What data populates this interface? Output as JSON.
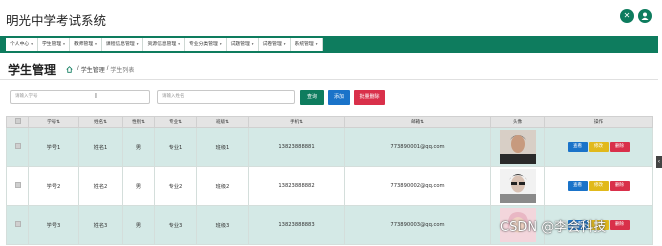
{
  "app": {
    "title": "明光中学考试系统"
  },
  "header_icons": [
    {
      "icon": "close-circle-icon",
      "glyph": "✕"
    },
    {
      "icon": "user-icon",
      "glyph": "●"
    }
  ],
  "nav": {
    "items": [
      "个人中心",
      "学生管理",
      "教师管理",
      "课程信息管理",
      "资源信息管理",
      "专业分类管理",
      "试题管理",
      "试卷管理",
      "系统管理"
    ],
    "caret": "▾"
  },
  "page": {
    "title": "学生管理",
    "breadcrumb": [
      "学生管理",
      "学生列表"
    ]
  },
  "search": {
    "student_no_placeholder": "请输入学号",
    "name_placeholder": "请输入姓名",
    "query_label": "查询",
    "add_label": "添加",
    "bulk_delete_label": "批量删除"
  },
  "table": {
    "headers": [
      "学号⇅",
      "姓名⇅",
      "性别⇅",
      "专业⇅",
      "班级⇅",
      "手机⇅",
      "邮箱⇅",
      "头像",
      "操作"
    ],
    "rows": [
      {
        "student_no": "学号1",
        "name": "姓名1",
        "gender": "男",
        "major": "专业1",
        "class": "班级1",
        "phone": "13823888881",
        "email": "773890001@qq.com"
      },
      {
        "student_no": "学号2",
        "name": "姓名2",
        "gender": "男",
        "major": "专业2",
        "class": "班级2",
        "phone": "13823888882",
        "email": "773890002@qq.com"
      },
      {
        "student_no": "学号3",
        "name": "姓名3",
        "gender": "男",
        "major": "专业3",
        "class": "班级3",
        "phone": "13823888883",
        "email": "773890003@qq.com"
      }
    ],
    "actions": {
      "view": "查看",
      "edit": "修改",
      "delete": "删除"
    }
  },
  "watermark": "CSDN @李会科技",
  "colors": {
    "primary": "#0e7c5e",
    "blue": "#1a73c9",
    "yellow": "#e1b91b",
    "red": "#d9304a",
    "row_tint": "#d4e9e6"
  }
}
